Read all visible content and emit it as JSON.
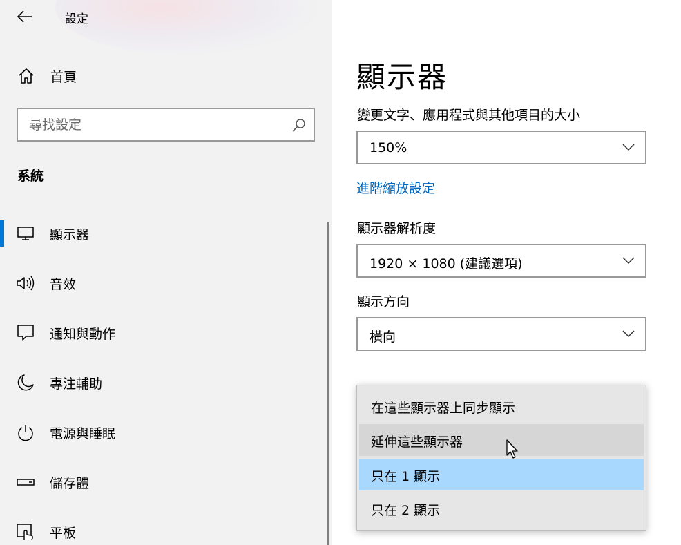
{
  "window": {
    "title": "設定"
  },
  "sidebar": {
    "home_label": "首頁",
    "search": {
      "placeholder": "尋找設定",
      "value": ""
    },
    "section_label": "系統",
    "items": [
      {
        "label": "顯示器",
        "icon": "monitor-icon",
        "active": true
      },
      {
        "label": "音效",
        "icon": "speaker-icon",
        "active": false
      },
      {
        "label": "通知與動作",
        "icon": "notification-icon",
        "active": false
      },
      {
        "label": "專注輔助",
        "icon": "moon-icon",
        "active": false
      },
      {
        "label": "電源與睡眠",
        "icon": "power-icon",
        "active": false
      },
      {
        "label": "儲存體",
        "icon": "storage-icon",
        "active": false
      },
      {
        "label": "平板",
        "icon": "tablet-icon",
        "active": false
      }
    ]
  },
  "main": {
    "page_title": "顯示器",
    "scale": {
      "label": "變更文字、應用程式與其他項目的大小",
      "value": "150%"
    },
    "advanced_link": "進階縮放設定",
    "resolution": {
      "label": "顯示器解析度",
      "value": "1920 × 1080 (建議選項)"
    },
    "orientation": {
      "label": "顯示方向",
      "value": "橫向"
    },
    "multi_display_menu": {
      "options": [
        {
          "label": "在這些顯示器上同步顯示",
          "state": "normal"
        },
        {
          "label": "延伸這些顯示器",
          "state": "hover"
        },
        {
          "label": "只在 1 顯示",
          "state": "selected"
        },
        {
          "label": "只在 2 顯示",
          "state": "normal"
        }
      ]
    }
  },
  "colors": {
    "accent": "#0078d7",
    "link": "#0067c0",
    "selected": "#a9d8ff",
    "hover": "#d6d6d6"
  }
}
